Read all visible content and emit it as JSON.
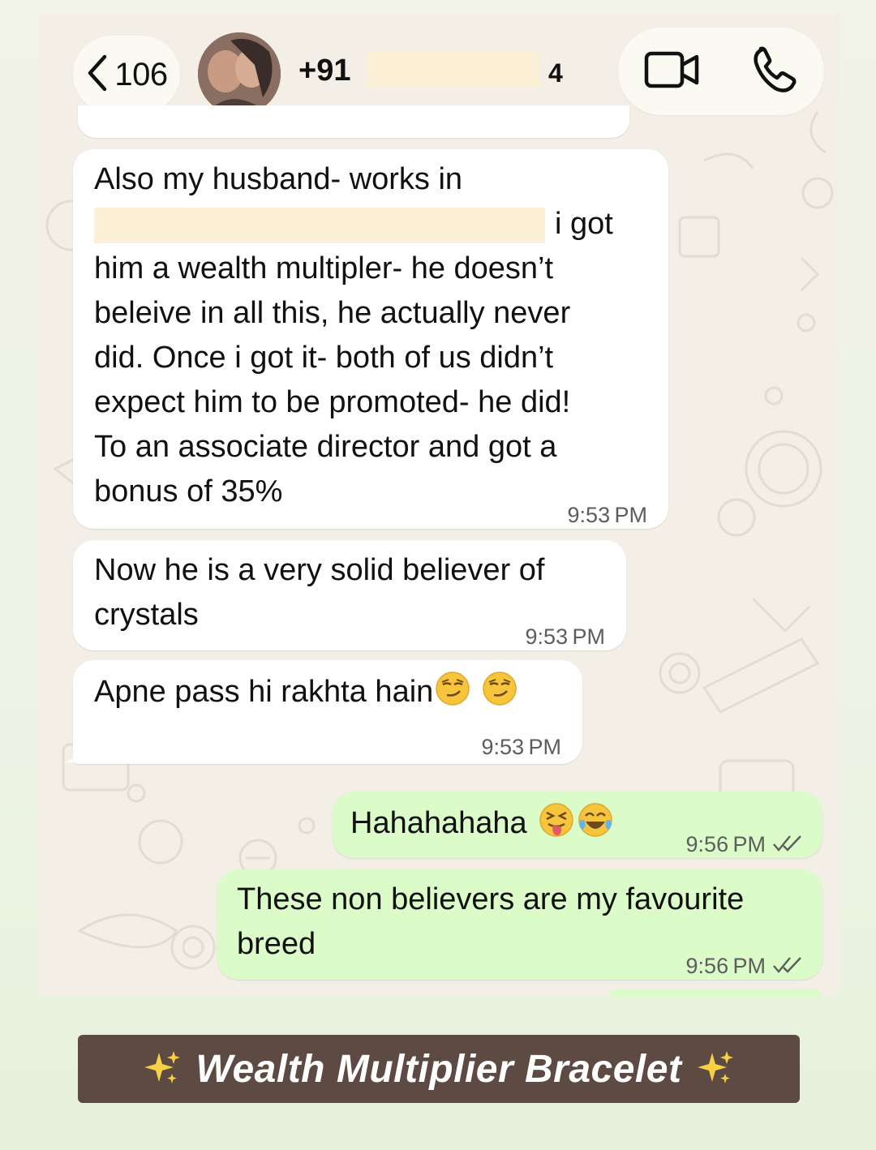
{
  "header": {
    "back_count": "106",
    "contact_prefix": "+91",
    "contact_suffix": "4",
    "icons": [
      "chevron-left-icon",
      "video-camera-icon",
      "phone-icon"
    ]
  },
  "messages": [
    {
      "direction": "incoming",
      "lines": [
        "Also my husband- works in",
        "i got",
        "him a wealth multipler- he doesn’t",
        "beleive in all this, he actually never",
        "did. Once i got it- both of us didn’t",
        "expect him to be promoted- he did!",
        "To an associate director and got a",
        "bonus of 35%"
      ],
      "time": "9:53 PM"
    },
    {
      "direction": "incoming",
      "lines": [
        "Now he is a very solid believer of",
        "crystals"
      ],
      "time": "9:53 PM"
    },
    {
      "direction": "incoming",
      "lines": [
        "Apne pass hi rakhta hain"
      ],
      "emojis": [
        "smirking-face",
        "smirking-face"
      ],
      "time": "9:53 PM"
    },
    {
      "direction": "outgoing",
      "lines": [
        "Hahahahaha"
      ],
      "emojis": [
        "tongue-out-face",
        "tears-of-joy-face"
      ],
      "time": "9:56 PM",
      "status": "read"
    },
    {
      "direction": "outgoing",
      "lines": [
        "These non believers are my favourite",
        "breed"
      ],
      "time": "9:56 PM",
      "status": "read"
    }
  ],
  "banner": {
    "label": "Wealth Multiplier Bracelet",
    "icons": [
      "sparkles-icon",
      "sparkles-icon"
    ]
  },
  "colors": {
    "incoming_bubble": "#ffffff",
    "outgoing_bubble": "#dbfbc9",
    "chat_background": "#f3efe6",
    "banner_background": "#5c4a43",
    "read_ticks": "#5d5d5d"
  }
}
